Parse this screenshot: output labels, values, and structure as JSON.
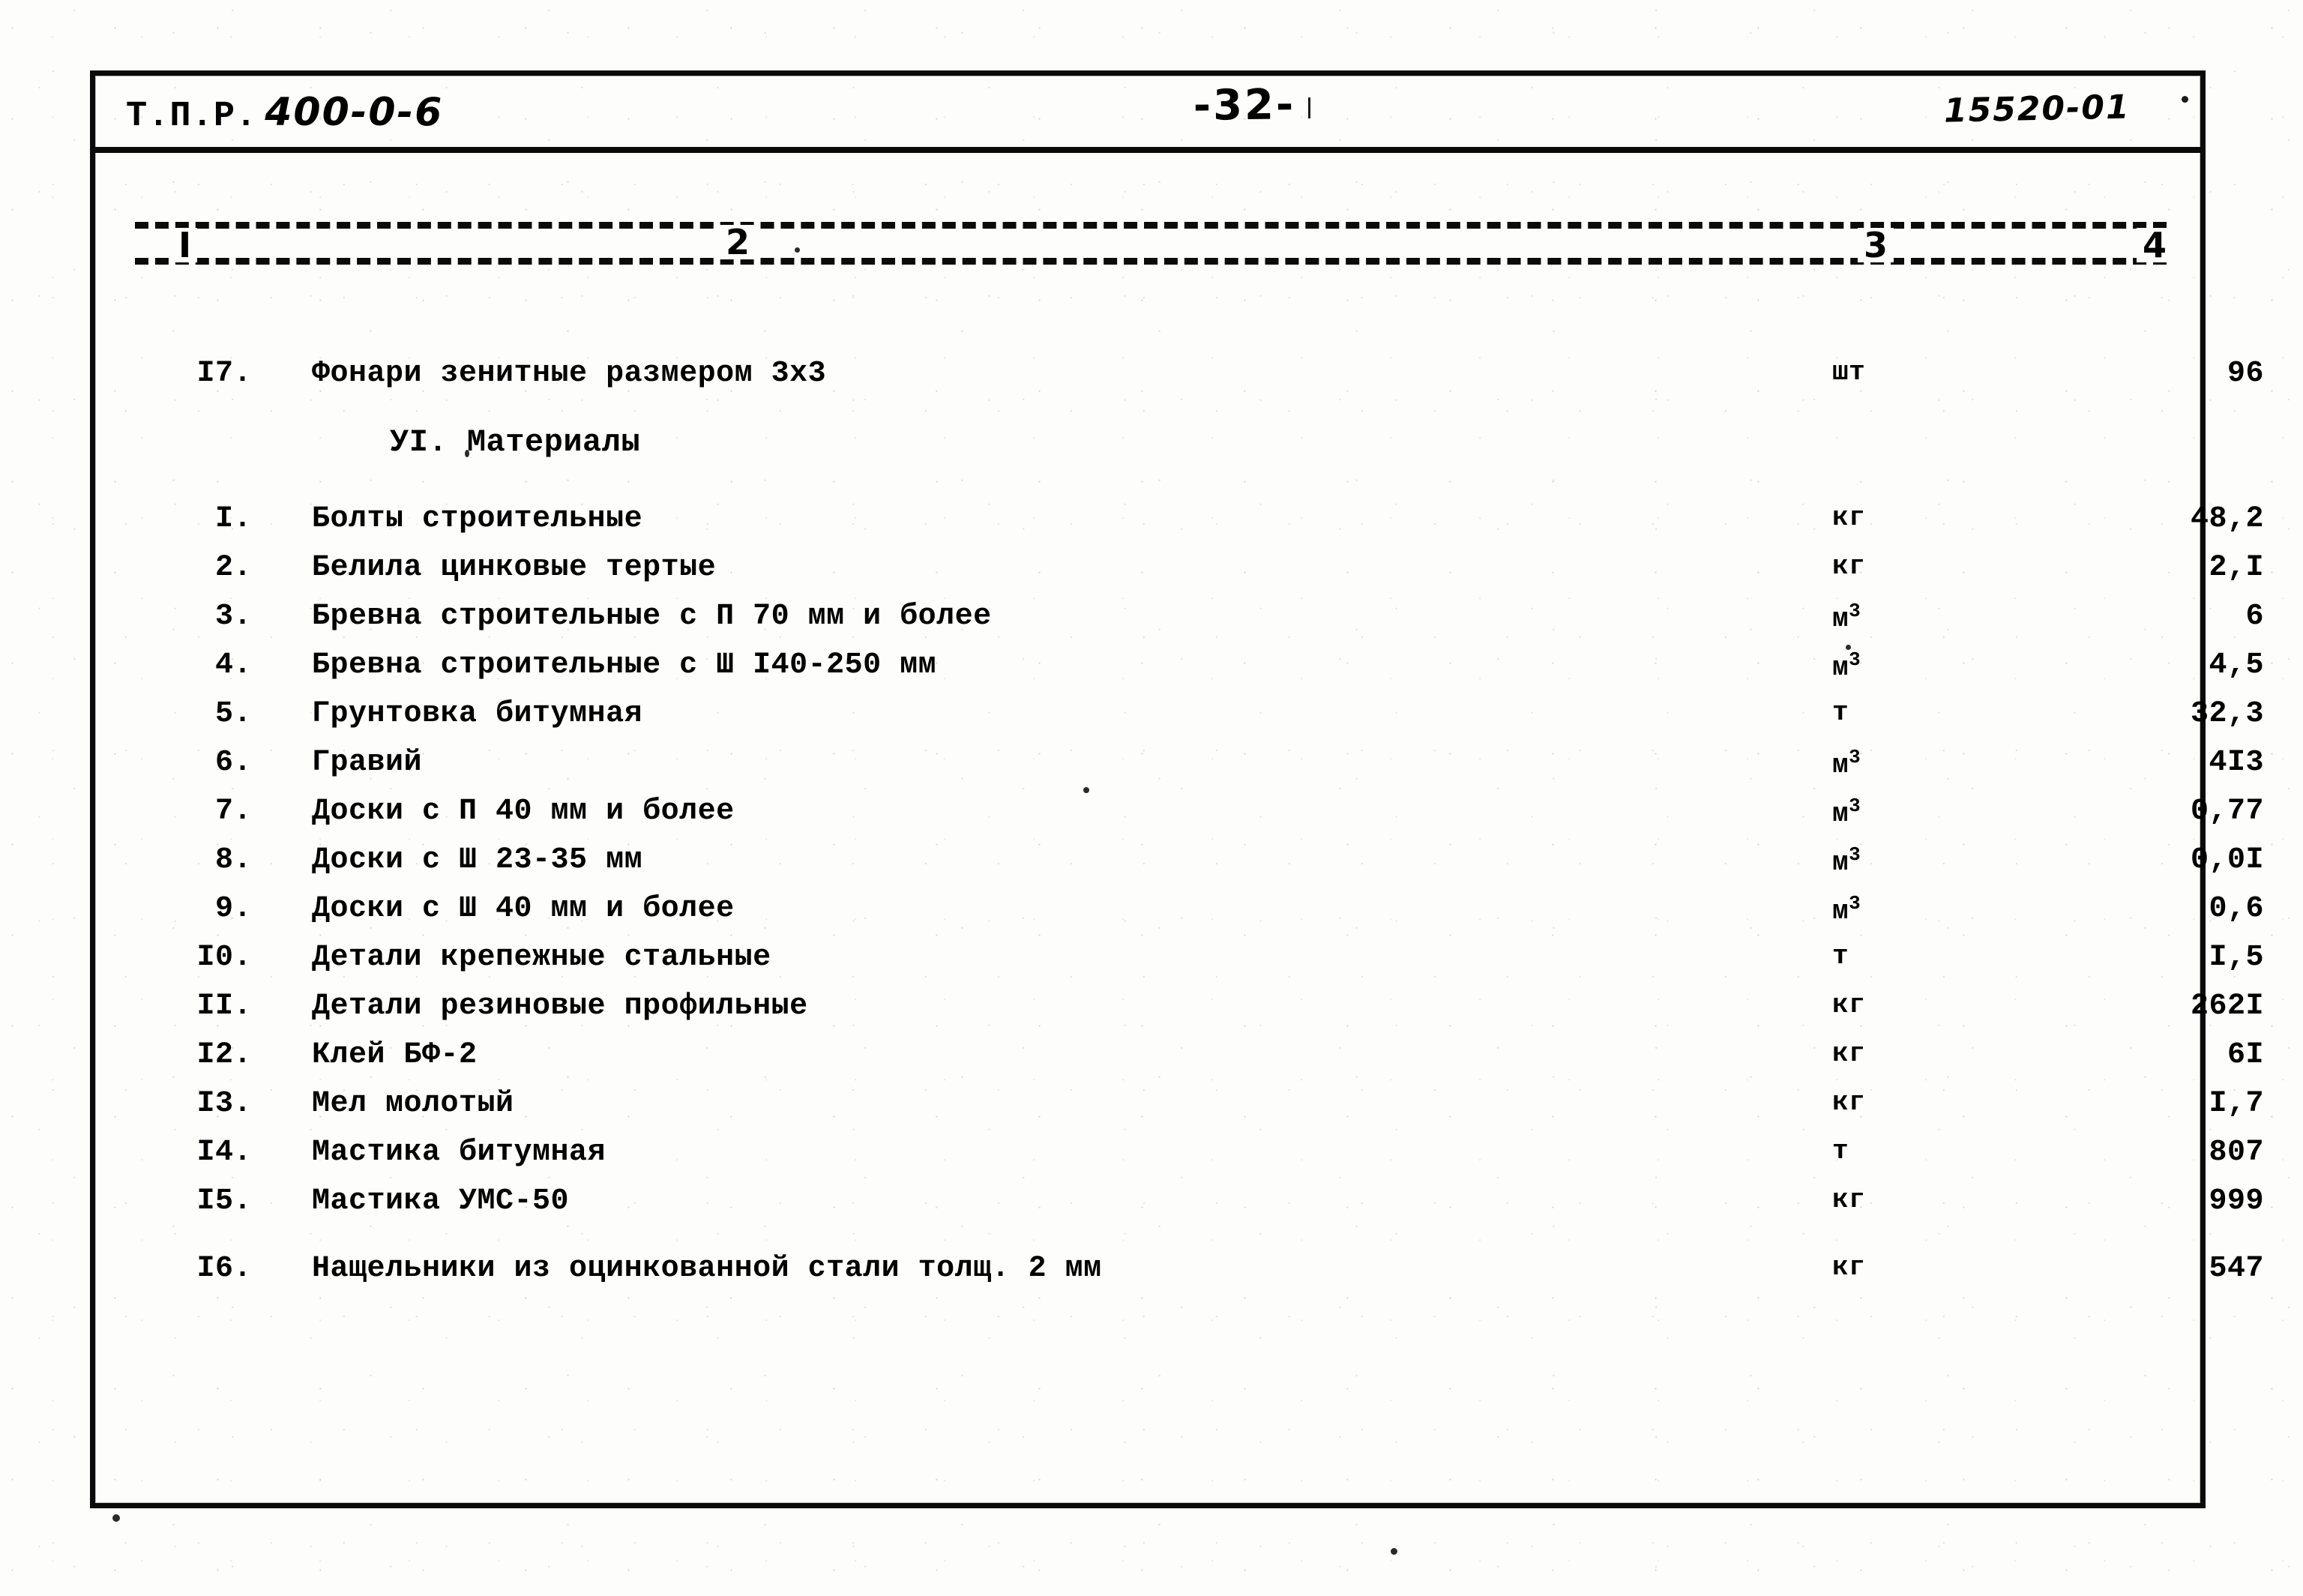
{
  "header": {
    "doc_code_label": "Т.П.Р.",
    "doc_code_value": "400-0-6",
    "page_number": "-32-",
    "archive_code": "15520-01"
  },
  "table": {
    "column_headers": [
      "I",
      "2",
      "3",
      "4"
    ],
    "intro_row": {
      "num": "I7.",
      "name": "Фонари зенитные размером 3х3",
      "unit": "шт",
      "unit_sup": "",
      "qty": "96"
    },
    "section_title": "УI. Материалы",
    "rows": [
      {
        "num": "I.",
        "name": "Болты строительные",
        "unit": "кг",
        "unit_sup": "",
        "qty": "48,2"
      },
      {
        "num": "2.",
        "name": "Белила цинковые тертые",
        "unit": "кг",
        "unit_sup": "",
        "qty": "2,I"
      },
      {
        "num": "3.",
        "name": "Бревна строительные с П 70 мм и более",
        "unit": "м",
        "unit_sup": "3",
        "qty": "6"
      },
      {
        "num": "4.",
        "name": "Бревна строительные с Ш I40-250 мм",
        "unit": "м",
        "unit_sup": "3",
        "qty": "4,5"
      },
      {
        "num": "5.",
        "name": "Грунтовка битумная",
        "unit": "т",
        "unit_sup": "",
        "qty": "32,3"
      },
      {
        "num": "6.",
        "name": "Гравий",
        "unit": "м",
        "unit_sup": "3",
        "qty": "4I3"
      },
      {
        "num": "7.",
        "name": "Доски с П 40 мм и более",
        "unit": "м",
        "unit_sup": "3",
        "qty": "0,77"
      },
      {
        "num": "8.",
        "name": "Доски с Ш 23-35 мм",
        "unit": "м",
        "unit_sup": "3",
        "qty": "0,0I"
      },
      {
        "num": "9.",
        "name": "Доски с Ш 40 мм и более",
        "unit": "м",
        "unit_sup": "3",
        "qty": "0,6"
      },
      {
        "num": "I0.",
        "name": "Детали крепежные стальные",
        "unit": "т",
        "unit_sup": "",
        "qty": "I,5"
      },
      {
        "num": "II.",
        "name": "Детали резиновые профильные",
        "unit": "кг",
        "unit_sup": "",
        "qty": "262I"
      },
      {
        "num": "I2.",
        "name": "Клей БФ-2",
        "unit": "кг",
        "unit_sup": "",
        "qty": "6I"
      },
      {
        "num": "I3.",
        "name": "Мел молотый",
        "unit": "кг",
        "unit_sup": "",
        "qty": "I,7"
      },
      {
        "num": "I4.",
        "name": "Мастика битумная",
        "unit": "т",
        "unit_sup": "",
        "qty": "807"
      },
      {
        "num": "I5.",
        "name": "Мастика УМС-50",
        "unit": "кг",
        "unit_sup": "",
        "qty": "999"
      },
      {
        "num": "I6.",
        "name": "Нащельники из оцинкованной стали толщ. 2 мм",
        "unit": "кг",
        "unit_sup": "",
        "qty": "547"
      }
    ]
  }
}
